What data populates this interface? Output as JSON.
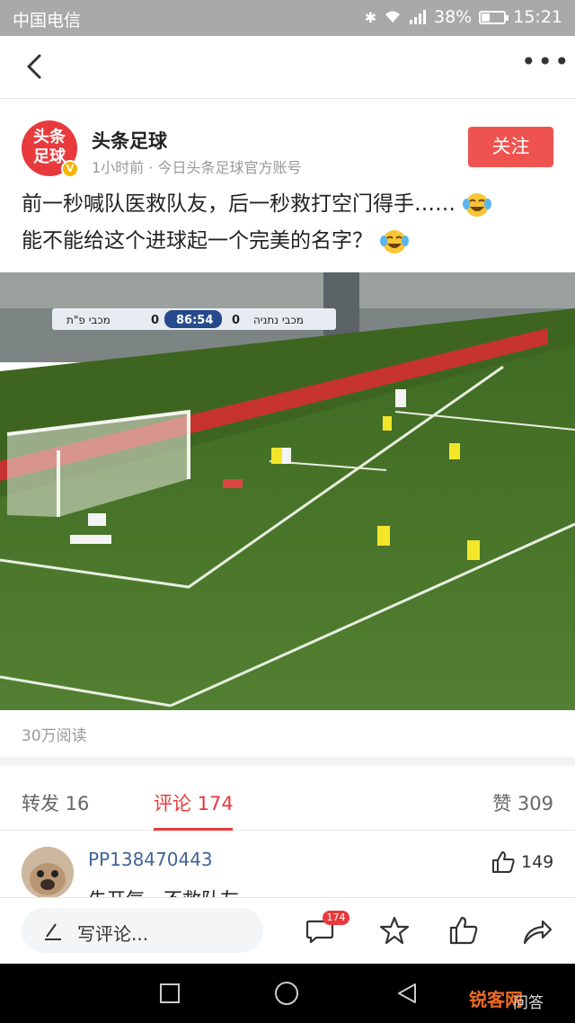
{
  "status_bar": {
    "carrier": "中国电信",
    "battery": "38%",
    "battery_level": 0.38,
    "time": "15:21"
  },
  "nav": {
    "back_icon": "chevron-left-icon",
    "more_icon": "more-dots-icon"
  },
  "author": {
    "logo_text_1": "头条",
    "logo_text_2": "足球",
    "verified": "V",
    "name": "头条足球",
    "meta": "1小时前 · 今日头条足球官方账号",
    "follow_label": "关注"
  },
  "post": {
    "line1": "前一秒喊队医救队友，后一秒救打空门得手……",
    "line2": "能不能给这个进球起一个完美的名字？"
  },
  "video": {
    "scoreboard_home": "מכבי נתניה",
    "scoreboard_home_score": "0",
    "scoreboard_time": "86:54",
    "scoreboard_away_score": "0",
    "scoreboard_away": "מכבי פ\"ת"
  },
  "stats": {
    "reads": "30万阅读"
  },
  "tabs": {
    "repost": "转发 16",
    "comments": "评论 174",
    "likes": "赞 309"
  },
  "comment": {
    "user": "PP138470443",
    "like_count": "149",
    "text": "先开气，不救队友"
  },
  "bottom_bar": {
    "input_label": "写评论...",
    "comment_badge": "174",
    "icons": [
      "comment-icon",
      "star-icon",
      "thumb-up-icon",
      "share-icon"
    ]
  },
  "watermark": {
    "brand": "锐客网",
    "suffix": "问答"
  },
  "colors": {
    "accent": "#e8393c",
    "follow_button": "#ef5350",
    "username_link": "#406599",
    "pitch_green": "#4e7a2e"
  }
}
